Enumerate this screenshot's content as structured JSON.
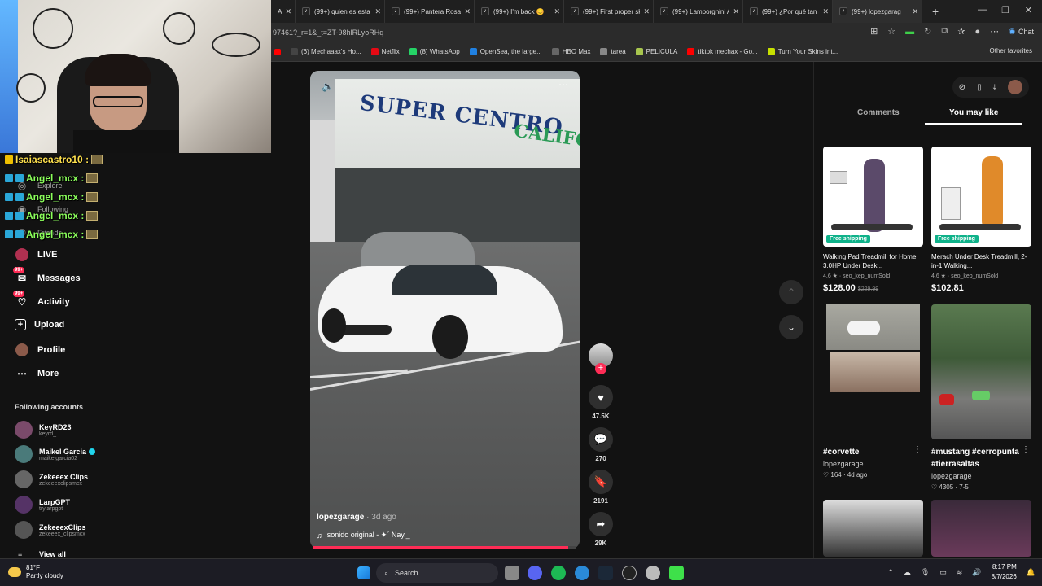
{
  "browser": {
    "tabs": [
      {
        "label": "(99+) quien es esta b"
      },
      {
        "label": "(99+) Pantera Rosa h"
      },
      {
        "label": "(99+) I'm back 😊"
      },
      {
        "label": "(99+) First proper sk"
      },
      {
        "label": "(99+) Lamborghini A"
      },
      {
        "label": "(99+) ¿Por qué tan sc"
      },
      {
        "label": "(99+) lopezgarag"
      }
    ],
    "close_glyph": "✕",
    "new_tab_glyph": "+",
    "url": "97461?_r=1&_t=ZT-98hlRLyoRHq",
    "chat_label": "Chat",
    "favorites": [
      {
        "label": "(6) Mechaaax's Ho...",
        "color": "#444444"
      },
      {
        "label": "Netflix",
        "color": "#e50914"
      },
      {
        "label": "(8) WhatsApp",
        "color": "#25d366"
      },
      {
        "label": "OpenSea, the large...",
        "color": "#2081e2"
      },
      {
        "label": "HBO Max",
        "color": "#666666"
      },
      {
        "label": "tarea",
        "color": "#888888"
      },
      {
        "label": "PELICULA",
        "color": "#a8c64e"
      },
      {
        "label": "tiktok mechax - Go...",
        "color": "#ff0000"
      },
      {
        "label": "Turn Your Skins int...",
        "color": "#c7e000"
      }
    ],
    "other_favorites": "Other favorites"
  },
  "chat_overlay": [
    {
      "user": "Isaiascastro10 :"
    },
    {
      "user": "Angel_mcx :"
    },
    {
      "user": "Angel_mcx :"
    },
    {
      "user": "Angel_mcx :"
    },
    {
      "user": "Angel_mcx :"
    }
  ],
  "sidebar": {
    "hidden_items": [
      "Explore",
      "Following",
      "Friends"
    ],
    "items": [
      {
        "label": "LIVE",
        "icon": "live-icon"
      },
      {
        "label": "Messages",
        "icon": "messages-icon",
        "badge": "99+"
      },
      {
        "label": "Activity",
        "icon": "activity-icon",
        "badge": "99+"
      },
      {
        "label": "Upload",
        "icon": "upload-icon"
      },
      {
        "label": "Profile",
        "icon": "profile-icon"
      },
      {
        "label": "More",
        "icon": "more-icon"
      }
    ],
    "following_header": "Following accounts",
    "accounts": [
      {
        "name": "KeyRD23",
        "handle": "keyrd_",
        "verified": false
      },
      {
        "name": "Maikel Garcia",
        "handle": "maikelgarcia02",
        "verified": true
      },
      {
        "name": "Zekeeex Clips",
        "handle": "zekeeexclipsmcx",
        "verified": false
      },
      {
        "name": "LarpGPT",
        "handle": "trylarpgpt",
        "verified": false
      },
      {
        "name": "ZekeeexClips",
        "handle": "zekeeex_clipsmcx",
        "verified": false
      }
    ],
    "view_all": "View all"
  },
  "video": {
    "sign_text": "SUPER CENTRO",
    "sign_text2": "CALIFORN",
    "username": "lopezgarage",
    "posted": "3d ago",
    "sound": "sonido original - ✦ˊ Nay._",
    "progress": 0.97,
    "actions": [
      {
        "name": "like",
        "icon": "heart-icon",
        "count": "47.5K"
      },
      {
        "name": "comment",
        "icon": "comment-icon",
        "count": "270"
      },
      {
        "name": "save",
        "icon": "bookmark-icon",
        "count": "2191"
      },
      {
        "name": "share",
        "icon": "share-icon",
        "count": "29K"
      }
    ]
  },
  "right_panel": {
    "tabs": [
      "Comments",
      "You may like"
    ],
    "active_tab": "You may like",
    "products": [
      {
        "ship": "Free shipping",
        "title": "Walking Pad Treadmill for Home, 3.0HP Under Desk...",
        "rating": "4.6 ★ · seo_kep_numSold",
        "price": "$128.00",
        "old_price": "$229.99"
      },
      {
        "ship": "Free shipping",
        "title": "Merach Under Desk Treadmill, 2-in-1 Walking...",
        "rating": "4.6 ★ · seo_kep_numSold",
        "price": "$102.81",
        "old_price": ""
      }
    ],
    "videos": [
      {
        "tags": "#corvette",
        "user": "lopezgarage",
        "meta": "♡ 164 · 4d ago"
      },
      {
        "tags": "#mustang #cerropunta #tierrasaltas",
        "user": "lopezgarage",
        "meta": "♡ 4305 · 7-5"
      }
    ]
  },
  "taskbar": {
    "temp": "81°F",
    "weather": "Partly cloudy",
    "search_placeholder": "Search",
    "time": "8:17 PM",
    "date": "8/7/2026"
  }
}
